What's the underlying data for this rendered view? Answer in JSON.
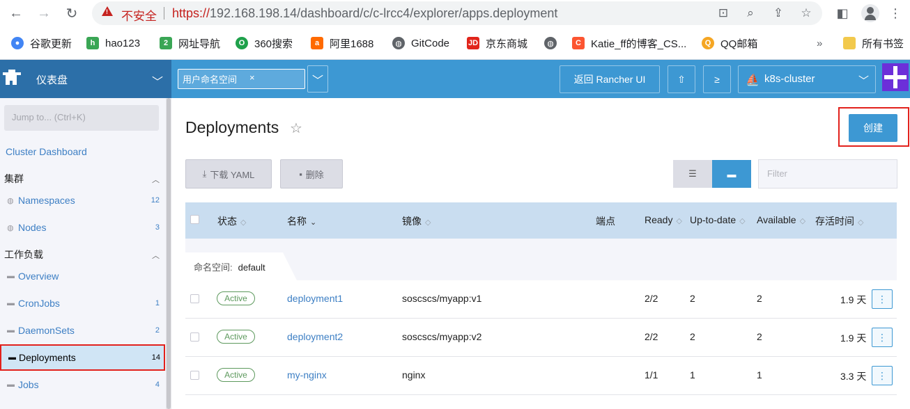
{
  "browser": {
    "security_label": "不安全",
    "url_scheme": "https://",
    "url_rest": "192.168.198.14/dashboard/c/c-lrcc4/explorer/apps.deployment",
    "bookmarks": [
      {
        "label": "谷歌更新",
        "icon": "chrome-icon",
        "color": "#4285f4"
      },
      {
        "label": "hao123",
        "icon": "hao123-icon",
        "color": "#3aa655"
      },
      {
        "label": "网址导航",
        "icon": "2345-icon",
        "color": "#3aa655"
      },
      {
        "label": "360搜索",
        "icon": "360-icon",
        "color": "#1fa14b"
      },
      {
        "label": "阿里1688",
        "icon": "1688-icon",
        "color": "#ff6a00"
      },
      {
        "label": "GitCode",
        "icon": "globe-icon",
        "color": "#5f6368"
      },
      {
        "label": "京东商城",
        "icon": "jd-icon",
        "color": "#e1251b"
      },
      {
        "label": "",
        "icon": "globe-icon",
        "color": "#5f6368"
      },
      {
        "label": "Katie_ff的博客_CS...",
        "icon": "csdn-icon",
        "color": "#fc5531"
      },
      {
        "label": "QQ邮箱",
        "icon": "qqmail-icon",
        "color": "#f5a623"
      }
    ],
    "overflow": "»",
    "all_bookmarks": "所有书签"
  },
  "header": {
    "brand_title": "仪表盘",
    "namespace_chip": "用户命名空间",
    "namespace_chip_close": "×",
    "back_to_rancher": "返回 Rancher UI",
    "cluster_name": "k8s-cluster",
    "accent": "#3d98d3"
  },
  "sidebar": {
    "jump_placeholder": "Jump to... (Ctrl+K)",
    "cluster_dashboard": "Cluster Dashboard",
    "group_cluster": "集群",
    "cluster_items": [
      {
        "label": "Namespaces",
        "count": "12"
      },
      {
        "label": "Nodes",
        "count": "3"
      }
    ],
    "group_workload": "工作负载",
    "workload_items": [
      {
        "label": "Overview",
        "count": ""
      },
      {
        "label": "CronJobs",
        "count": "1"
      },
      {
        "label": "DaemonSets",
        "count": "2"
      },
      {
        "label": "Deployments",
        "count": "14"
      },
      {
        "label": "Jobs",
        "count": "4"
      }
    ]
  },
  "main": {
    "title": "Deployments",
    "create_label": "创建",
    "download_yaml": "下载 YAML",
    "delete_label": "删除",
    "filter_placeholder": "Filter",
    "columns": [
      "状态",
      "名称",
      "镜像",
      "端点",
      "Ready",
      "Up-to-date",
      "Available",
      "存活时间"
    ],
    "group_prefix": "命名空间:",
    "group_name": "default",
    "rows": [
      {
        "state": "Active",
        "name": "deployment1",
        "image": "soscscs/myapp:v1",
        "ready": "2/2",
        "up_to_date": "2",
        "available": "2",
        "age": "1.9 天"
      },
      {
        "state": "Active",
        "name": "deployment2",
        "image": "soscscs/myapp:v2",
        "ready": "2/2",
        "up_to_date": "2",
        "available": "2",
        "age": "1.9 天"
      },
      {
        "state": "Active",
        "name": "my-nginx",
        "image": "nginx",
        "ready": "1/1",
        "up_to_date": "1",
        "available": "1",
        "age": "3.3 天"
      }
    ]
  }
}
